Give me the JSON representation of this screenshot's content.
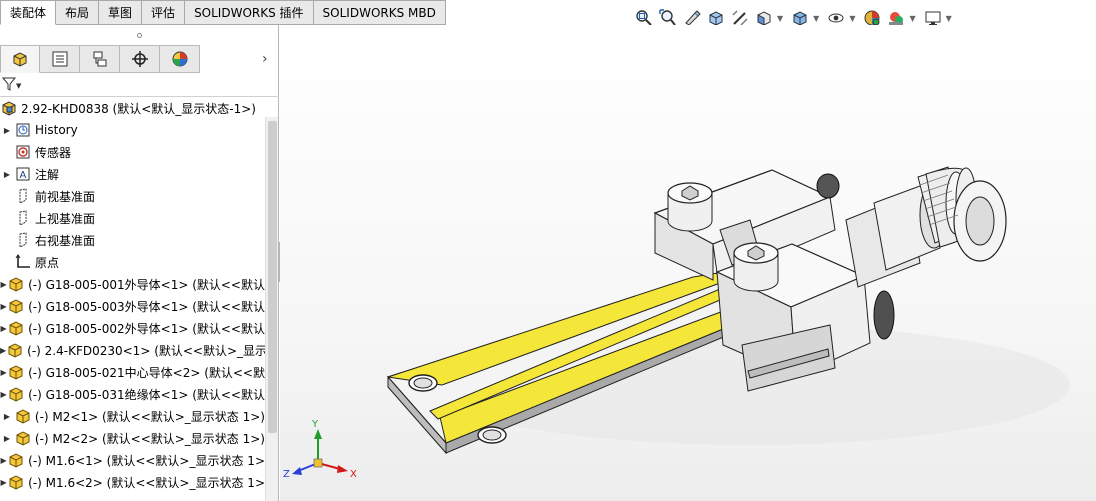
{
  "tabs": [
    {
      "label": "装配体",
      "active": true
    },
    {
      "label": "布局",
      "active": false
    },
    {
      "label": "草图",
      "active": false
    },
    {
      "label": "评估",
      "active": false
    },
    {
      "label": "SOLIDWORKS 插件",
      "active": false
    },
    {
      "label": "SOLIDWORKS MBD",
      "active": false
    }
  ],
  "hud_icons": [
    "zoom-to-fit-icon",
    "zoom-to-area-icon",
    "previous-view-icon",
    "section-view-icon",
    "dynamic-annotation-icon",
    "view-orientation-icon",
    "display-style-icon",
    "hide-show-items-icon",
    "edit-appearance-icon",
    "apply-scene-icon",
    "view-settings-icon"
  ],
  "manager_tabs": [
    "featuremanager-tab",
    "propertymanager-tab",
    "configurationmanager-tab",
    "dimxpertmanager-tab",
    "displaymanager-tab"
  ],
  "tree": {
    "root": "2.92-KHD0838  (默认<默认_显示状态-1>)",
    "items": [
      {
        "label": "History",
        "icon": "history-icon",
        "expandable": true
      },
      {
        "label": "传感器",
        "icon": "sensor-icon",
        "expandable": false
      },
      {
        "label": "注解",
        "icon": "annotation-icon",
        "expandable": true
      },
      {
        "label": "前视基准面",
        "icon": "plane-icon",
        "expandable": false
      },
      {
        "label": "上视基准面",
        "icon": "plane-icon",
        "expandable": false
      },
      {
        "label": "右视基准面",
        "icon": "plane-icon",
        "expandable": false
      },
      {
        "label": "原点",
        "icon": "origin-icon",
        "expandable": false
      },
      {
        "label": "(-) G18-005-001外导体<1>  (默认<<默认",
        "icon": "part-icon",
        "expandable": true
      },
      {
        "label": "(-) G18-005-003外导体<1>  (默认<<默认",
        "icon": "part-icon",
        "expandable": true
      },
      {
        "label": "(-) G18-005-002外导体<1>  (默认<<默认",
        "icon": "part-icon",
        "expandable": true
      },
      {
        "label": "(-) 2.4-KFD0230<1>  (默认<<默认>_显示",
        "icon": "part-icon",
        "expandable": true
      },
      {
        "label": "(-) G18-005-021中心导体<2>  (默认<<默",
        "icon": "part-icon",
        "expandable": true
      },
      {
        "label": "(-) G18-005-031绝缘体<1>  (默认<<默认",
        "icon": "part-icon",
        "expandable": true
      },
      {
        "label": "(-) M2<1>  (默认<<默认>_显示状态 1>)",
        "icon": "part-icon",
        "expandable": true
      },
      {
        "label": "(-) M2<2>  (默认<<默认>_显示状态 1>)",
        "icon": "part-icon",
        "expandable": true
      },
      {
        "label": "(-) M1.6<1>  (默认<<默认>_显示状态 1>",
        "icon": "part-icon",
        "expandable": true
      },
      {
        "label": "(-) M1.6<2>  (默认<<默认>_显示状态 1>",
        "icon": "part-icon",
        "expandable": true
      }
    ]
  },
  "triad": {
    "x_label": "X",
    "y_label": "Y",
    "z_label": "Z"
  },
  "colors": {
    "pcb_yellow": "#f5e63a",
    "body_white": "#f4f4f4",
    "edge": "#222222",
    "triad_x": "#d21a1a",
    "triad_y": "#1f9d2b",
    "triad_z": "#2a3fd6"
  }
}
